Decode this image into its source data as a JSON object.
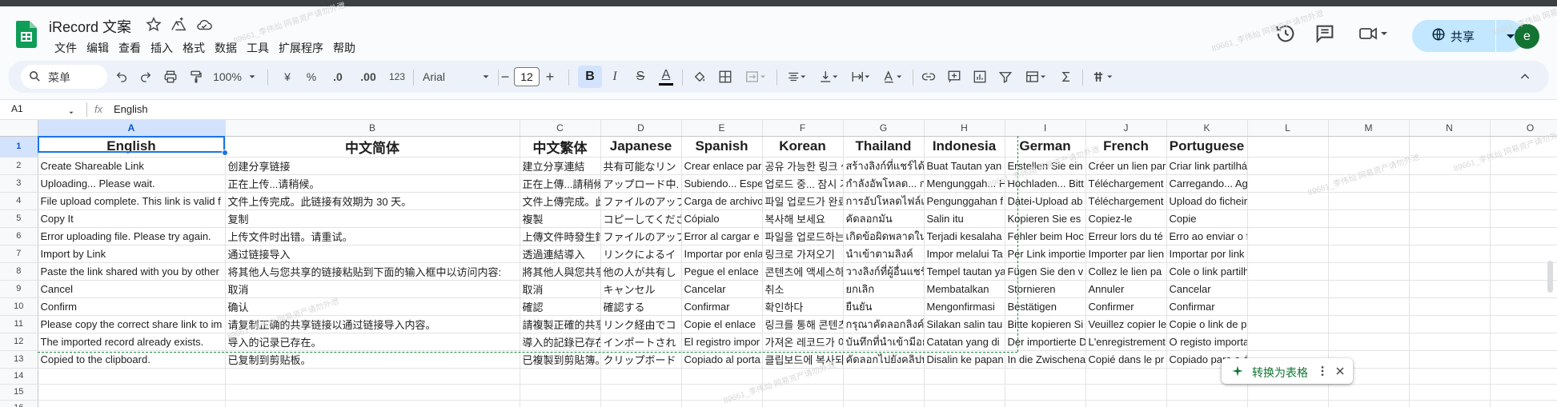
{
  "doc": {
    "title": "iRecord 文案"
  },
  "menu": [
    "文件",
    "编辑",
    "查看",
    "插入",
    "格式",
    "数据",
    "工具",
    "扩展程序",
    "帮助"
  ],
  "share": {
    "label": "共享"
  },
  "user": {
    "avatar_letter": "e"
  },
  "toolbar": {
    "search_placeholder": "菜单",
    "zoom": "100%",
    "currency": "¥",
    "percent": "%",
    "dec_less": ".0",
    "dec_more": ".00",
    "number_format": "123",
    "font": "Arial",
    "font_size": "12",
    "minus": "−",
    "plus": "+",
    "bold": "B",
    "italic": "I",
    "strike": "S",
    "text_color": "A"
  },
  "formula": {
    "cell": "A1",
    "fx": "fx",
    "value": "English"
  },
  "grid": {
    "columns": [
      "A",
      "B",
      "C",
      "D",
      "E",
      "F",
      "G",
      "H",
      "I",
      "J",
      "K",
      "L",
      "M",
      "N",
      "O"
    ],
    "row_numbers": [
      "1",
      "2",
      "3",
      "4",
      "5",
      "6",
      "7",
      "8",
      "9",
      "10",
      "11",
      "12",
      "13",
      "14",
      "15",
      "16"
    ],
    "rows": [
      [
        "English",
        "中文简体",
        "中文繁体",
        "Japanese",
        "Spanish",
        "Korean",
        "Thailand",
        "Indonesia",
        "German",
        "French",
        "Portuguese",
        "",
        "",
        "",
        ""
      ],
      [
        "Create Shareable Link",
        "创建分享链接",
        "建立分享連結",
        "共有可能なリン",
        "Crear enlace par",
        "공유 가능한 링크 생",
        "สร้างลิงก์ที่แชร์ได้",
        "Buat Tautan yan",
        "Erstellen Sie ein",
        "Créer un lien par",
        "Criar link partilhável",
        "",
        "",
        "",
        ""
      ],
      [
        "Uploading... Please wait.",
        "正在上传...请稍候。",
        "正在上傳...請稍候",
        "アップロード中.",
        "Subiendo... Espe",
        "업로드 중... 잠시 기",
        "กำลังอัพโหลด... ก",
        "Mengunggah... H",
        "Hochladen... Bitt",
        "Téléchargement",
        "Carregando... Aguarde.",
        "",
        "",
        "",
        ""
      ],
      [
        "File upload complete. This link is valid f",
        "文件上传完成。此链接有效期为 30 天。",
        "文件上傳完成。此",
        "ファイルのアップ",
        "Carga de archivo",
        "파일 업로드가 완료",
        "การอัปโหลดไฟล์เ",
        "Pengunggahan f",
        "Datei-Upload ab",
        "Téléchargement",
        "Upload do ficheiro concluído.",
        "",
        "",
        "",
        ""
      ],
      [
        "Copy It",
        "复制",
        "複製",
        "コピーしてくださ",
        "Cópialo",
        "복사해 보세요",
        "คัดลอกมัน",
        "Salin itu",
        "Kopieren Sie es",
        "Copiez-le",
        "Copie",
        "",
        "",
        "",
        ""
      ],
      [
        "Error uploading file. Please try again.",
        "上传文件时出错。请重试。",
        "上傳文件時發生錯",
        "ファイルのアップ",
        "Error al cargar e",
        "파일을 업로드하는",
        "เกิดข้อผิดพลาดใน",
        "Terjadi kesalaha",
        "Fehler beim Hoc",
        "Erreur lors du té",
        "Erro ao enviar o ficheiro.",
        "",
        "",
        "",
        ""
      ],
      [
        "Import by Link",
        "通过链接导入",
        "透過連結導入",
        "リンクによるイ",
        "Importar por enla",
        "링크로 가져오기",
        "นำเข้าตามลิงค์",
        "Impor melalui Ta",
        "Per Link importie",
        "Importer par lien",
        "Importar por link",
        "",
        "",
        "",
        ""
      ],
      [
        "Paste the link shared with you by other",
        "将其他人与您共享的链接粘贴到下面的输入框中以访问内容:",
        "將其他人與您共享",
        "他の人が共有し",
        "Pegue el enlace",
        "콘텐츠에 액세스하",
        "วางลิงก์ที่ผู้อื่นแชร์",
        "Tempel tautan ya",
        "Fügen Sie den v",
        "Collez le lien pa",
        "Cole o link partilhado consigo por outras pessoas na caixa de entrada abaixo pa",
        "",
        "",
        "",
        ""
      ],
      [
        "Cancel",
        "取消",
        "取消",
        "キャンセル",
        "Cancelar",
        "취소",
        "ยกเลิก",
        "Membatalkan",
        "Stornieren",
        "Annuler",
        "Cancelar",
        "",
        "",
        "",
        ""
      ],
      [
        "Confirm",
        "确认",
        "確認",
        "確認する",
        "Confirmar",
        "확인하다",
        "ยืนยัน",
        "Mengonfirmasi",
        "Bestätigen",
        "Confirmer",
        "Confirmar",
        "",
        "",
        "",
        ""
      ],
      [
        "Please copy the correct share link to im",
        "请复制正确的共享链接以通过链接导入内容。",
        "請複製正確的共享",
        "リンク経由でコ",
        "Copie el enlace",
        "링크를 통해 콘텐츠",
        "กรุณาคัดลอกลิงค์",
        "Silakan salin tau",
        "Bitte kopieren Si",
        "Veuillez copier le",
        "Copie o link de partilha correto para importar conteúdo através do link.",
        "",
        "",
        "",
        ""
      ],
      [
        "The imported record already exists.",
        "导入的记录已存在。",
        "導入的記錄已存在",
        "インポートされ",
        "El registro impor",
        "가져온 레코드가 이",
        "บันทึกที่นำเข้ามีอยู",
        "Catatan yang di",
        "Der importierte D",
        "L'enregistrement",
        "O registo importado já existe.",
        "",
        "",
        "",
        ""
      ],
      [
        "Copied to the clipboard.",
        "已复制到剪贴板。",
        "已複製到剪貼簿。",
        "クリップボード",
        "Copiado al porta",
        "클립보드에 복사되",
        "คัดลอกไปยังคลิปบ",
        "Disalin ke papan",
        "In die Zwischena",
        "Copié dans le pr",
        "Copiado para a área de transferência.",
        "",
        "",
        "",
        ""
      ],
      [
        "",
        "",
        "",
        "",
        "",
        "",
        "",
        "",
        "",
        "",
        "",
        "",
        "",
        "",
        ""
      ],
      [
        "",
        "",
        "",
        "",
        "",
        "",
        "",
        "",
        "",
        "",
        "",
        "",
        "",
        "",
        ""
      ],
      [
        "",
        "",
        "",
        "",
        "",
        "",
        "",
        "",
        "",
        "",
        "",
        "",
        "",
        "",
        ""
      ]
    ]
  },
  "chip": {
    "label": "转换为表格"
  },
  "watermark": "89661_李伟灿 网易资产请勿外泄"
}
